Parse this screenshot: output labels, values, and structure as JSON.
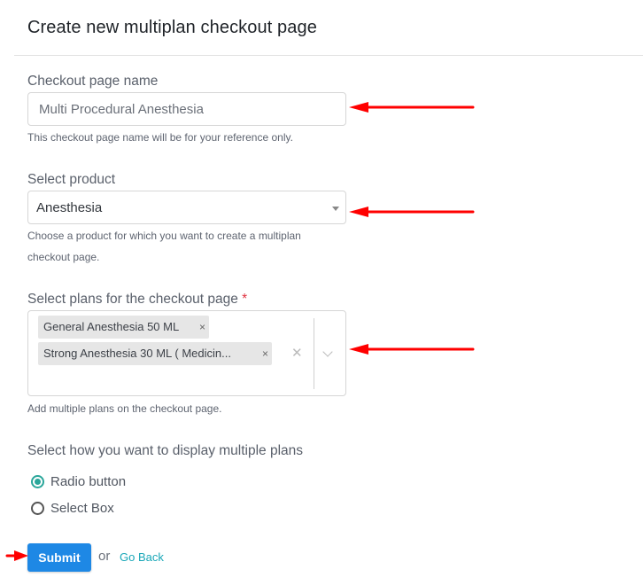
{
  "page": {
    "title": "Create new multiplan checkout page"
  },
  "checkout_name": {
    "label": "Checkout page name",
    "value": "Multi Procedural Anesthesia",
    "help": "This checkout page name will be for your reference only."
  },
  "product": {
    "label": "Select product",
    "selected": "Anesthesia",
    "help_line1": "Choose a product for which you want to create a multiplan",
    "help_line2": "checkout page."
  },
  "plans": {
    "label": "Select plans for the checkout page",
    "required_mark": "*",
    "selected": [
      "General Anesthesia 50 ML",
      "Strong Anesthesia 30 ML ( Medicin..."
    ],
    "remove_glyph": "×",
    "clear_glyph": "✕",
    "help": "Add multiple plans on the checkout page."
  },
  "display_mode": {
    "label": "Select how you want to display multiple plans",
    "options": [
      {
        "label": "Radio button",
        "checked": true
      },
      {
        "label": "Select Box",
        "checked": false
      }
    ]
  },
  "actions": {
    "submit_label": "Submit",
    "or_text": "or",
    "go_back_label": "Go Back"
  },
  "colors": {
    "primary": "#1e88e5",
    "accent": "#2aa69a",
    "link": "#1aa7b8",
    "annotation_arrow": "#ff0000"
  }
}
